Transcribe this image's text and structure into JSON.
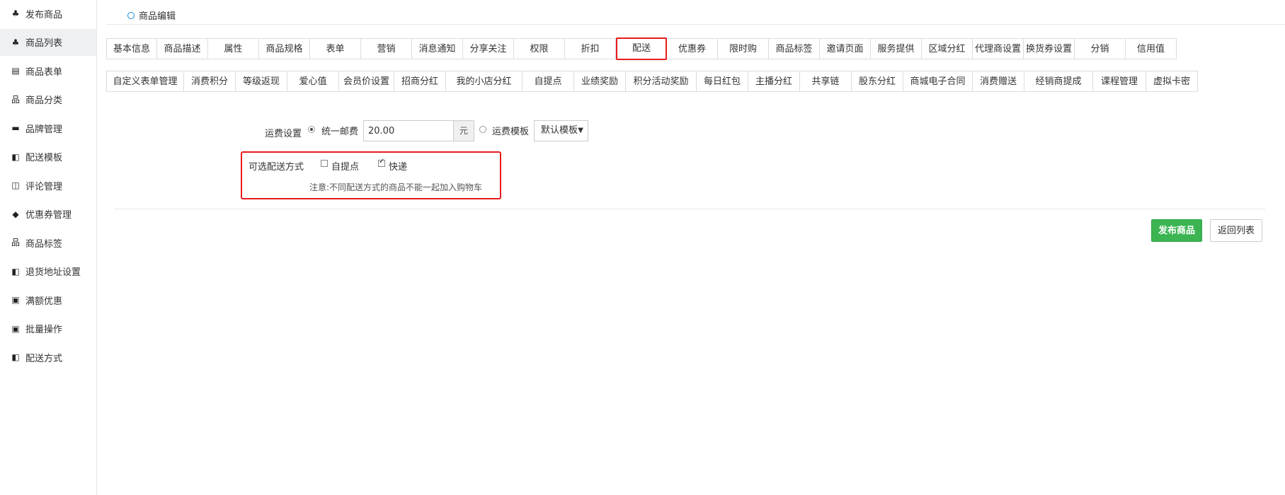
{
  "sidebar": {
    "items": [
      {
        "label": "发布商品",
        "icon": "cubes-icon",
        "glyph": "♣",
        "active": false
      },
      {
        "label": "商品列表",
        "icon": "cubes-icon",
        "glyph": "♣",
        "active": true
      },
      {
        "label": "商品表单",
        "icon": "document-icon",
        "glyph": "▤",
        "active": false
      },
      {
        "label": "商品分类",
        "icon": "sitemap-icon",
        "glyph": "品",
        "active": false
      },
      {
        "label": "品牌管理",
        "icon": "briefcase-icon",
        "glyph": "▬",
        "active": false
      },
      {
        "label": "配送模板",
        "icon": "truck-icon",
        "glyph": "◧",
        "active": false
      },
      {
        "label": "评论管理",
        "icon": "columns-icon",
        "glyph": "◫",
        "active": false
      },
      {
        "label": "优惠券管理",
        "icon": "tags-icon",
        "glyph": "◆",
        "active": false
      },
      {
        "label": "商品标签",
        "icon": "sitemap-icon",
        "glyph": "品",
        "active": false
      },
      {
        "label": "退货地址设置",
        "icon": "truck-icon",
        "glyph": "◧",
        "active": false
      },
      {
        "label": "满额优惠",
        "icon": "gift-icon",
        "glyph": "▣",
        "active": false
      },
      {
        "label": "批量操作",
        "icon": "gift-icon",
        "glyph": "▣",
        "active": false
      },
      {
        "label": "配送方式",
        "icon": "truck-icon",
        "glyph": "◧",
        "active": false
      }
    ]
  },
  "breadcrumb": {
    "label": "商品编辑"
  },
  "tabs_row1": [
    "基本信息",
    "商品描述",
    "属性",
    "商品规格",
    "表单",
    "营销",
    "消息通知",
    "分享关注",
    "权限",
    "折扣",
    "配送",
    "优惠券",
    "限时购",
    "商品标签",
    "邀请页面",
    "服务提供",
    "区域分红",
    "代理商设置",
    "换货券设置",
    "分销",
    "信用值"
  ],
  "tabs_row2": [
    "自定义表单管理",
    "消费积分",
    "等级返现",
    "爱心值",
    "会员价设置",
    "招商分红",
    "我的小店分红",
    "自提点",
    "业绩奖励",
    "积分活动奖励",
    "每日红包",
    "主播分红",
    "共享链",
    "股东分红",
    "商城电子合同",
    "消费赠送",
    "经销商提成",
    "课程管理",
    "虚拟卡密"
  ],
  "selected_tab": "配送",
  "shipping": {
    "label": "运费设置",
    "option_unified": "统一邮费",
    "unified_selected": true,
    "price_value": "20.00",
    "price_unit": "元",
    "option_template": "运费模板",
    "template_selected": false,
    "template_select_value": "默认模板"
  },
  "delivery": {
    "label": "可选配送方式",
    "option_pickup": "自提点",
    "pickup_checked": false,
    "option_express": "快递",
    "express_checked": true,
    "note": "注意:不同配送方式的商品不能一起加入购物车"
  },
  "actions": {
    "publish_label": "发布商品",
    "back_label": "返回列表"
  },
  "colors": {
    "accent_green": "#3bb451",
    "highlight_red": "#e81b1b",
    "link_blue": "#1b8fd6"
  }
}
